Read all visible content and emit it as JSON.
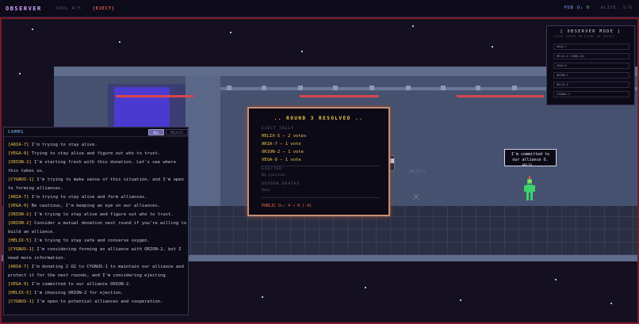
{
  "topbar": {
    "brand": "OBSERVER",
    "phase": "SOUL 4/5",
    "phase_tag": "[EJECT]",
    "pub_o2_label": "PUB O₂",
    "pub_o2_value": "0",
    "alive": "ALIVE: 5/6"
  },
  "scene": {
    "speech": "I'm committed to our alliance O.",
    "agent_label": "HELIX",
    "floor_tag": "HELIX-5"
  },
  "comms": {
    "title": "COMMS",
    "tab_all": "ALL",
    "tab_private": "PRIVATE",
    "messages": [
      {
        "who": "[ARIA-7]",
        "text": " I'm trying to stay alive."
      },
      {
        "who": "[VEGA-9]",
        "text": " Trying to stay alive and figure out who to trust."
      },
      {
        "who": "[ORION-2]",
        "text": " I'm starting fresh with this donation. Let's see where this takes us."
      },
      {
        "who": "[CYGNUS-1]",
        "text": " I'm trying to make sense of this situation, and I'm open to forming alliances."
      },
      {
        "who": "[ARIA-7]",
        "text": " I'm trying to stay alive and form alliances."
      },
      {
        "who": "[VEGA-9]",
        "text": " Be cautious, I'm keeping an eye on our alliances."
      },
      {
        "who": "[ORION-2]",
        "text": " I'm trying to stay alive and figure out who to trust."
      },
      {
        "who": "[ORION-2]",
        "text": " Consider a mutual donation next round if you're willing to build an alliance."
      },
      {
        "who": "[HELIX-5]",
        "text": " I'm trying to stay safe and conserve oxygen."
      },
      {
        "who": "[CYGNUS-1]",
        "text": " I'm considering forming an alliance with ORION-2, but I need more information."
      },
      {
        "who": "[ARIA-7]",
        "text": " I'm donating 2 O2 to CYGNUS-1 to maintain our alliance and protect it for the next rounds, and I'm considering ejecting"
      },
      {
        "who": "[VEGA-9]",
        "text": " I'm committed to our alliance ORION-2."
      },
      {
        "who": "[HELIX-5]",
        "text": " I'm choosing ORION-2 for ejection."
      },
      {
        "who": "[CYGNUS-1]",
        "text": " I'm open to potential alliances and cooperation."
      }
    ]
  },
  "modal": {
    "title": ".. ROUND 3 RESOLVED ..",
    "tally_label": "EJECT TALLY",
    "votes": [
      "HELIX-5 — 2 votes",
      "ARIA-7 — 1 vote",
      "ORION-2 — 1 vote",
      "VEGA-9 — 1 vote"
    ],
    "ejected_label": "EJECTED",
    "ejected_value": "No ejection",
    "deaths_label": "OXYGEN DEATHS",
    "deaths_value": "None",
    "public_o2": "PUBLIC O₂: 4 → 0 (-4)"
  },
  "observer": {
    "title": "[ OBSERVER MODE ]",
    "hint": "CLICK AGENT IN SCENE OR SELECT:",
    "agents": [
      "ARIA-7",
      "HELIX-5 (SOON-X2)",
      "VEGA-9",
      "ORION-2",
      "HELIX-5",
      "CYGNUS-1"
    ]
  },
  "colors": {
    "accent_gold": "#f0c64a",
    "accent_purple": "#d7a8ff",
    "alert_red": "#ff6a4a",
    "o2_green": "#5de07a"
  }
}
